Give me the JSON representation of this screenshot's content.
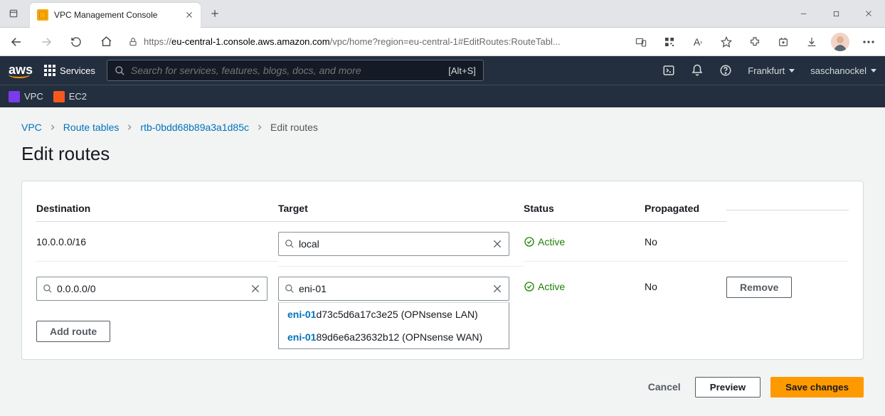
{
  "browser": {
    "tab_title": "VPC Management Console",
    "url_host": "eu-central-1.console.aws.amazon.com",
    "url_path": "/vpc/home?region=eu-central-1#EditRoutes:RouteTabl..."
  },
  "aws_nav": {
    "services_label": "Services",
    "search_placeholder": "Search for services, features, blogs, docs, and more",
    "search_shortcut": "[Alt+S]",
    "region": "Frankfurt",
    "user": "saschanockel"
  },
  "service_bar": {
    "vpc": "VPC",
    "ec2": "EC2"
  },
  "breadcrumb": {
    "vpc": "VPC",
    "route_tables": "Route tables",
    "rtb": "rtb-0bdd68b89a3a1d85c",
    "current": "Edit routes"
  },
  "page_title": "Edit routes",
  "table": {
    "headers": {
      "destination": "Destination",
      "target": "Target",
      "status": "Status",
      "propagated": "Propagated"
    },
    "rows": [
      {
        "destination": "10.0.0.0/16",
        "destination_editable": false,
        "target": "local",
        "status": "Active",
        "propagated": "No",
        "removable": false
      },
      {
        "destination": "0.0.0.0/0",
        "destination_editable": true,
        "target": "eni-01",
        "status": "Active",
        "propagated": "No",
        "removable": true
      }
    ],
    "dropdown_options": [
      {
        "match": "eni-01",
        "rest": "d73c5d6a17c3e25 (OPNsense LAN)"
      },
      {
        "match": "eni-01",
        "rest": "89d6e6a23632b12 (OPNsense WAN)"
      }
    ],
    "add_route_label": "Add route",
    "remove_label": "Remove"
  },
  "footer": {
    "cancel": "Cancel",
    "preview": "Preview",
    "save": "Save changes"
  }
}
